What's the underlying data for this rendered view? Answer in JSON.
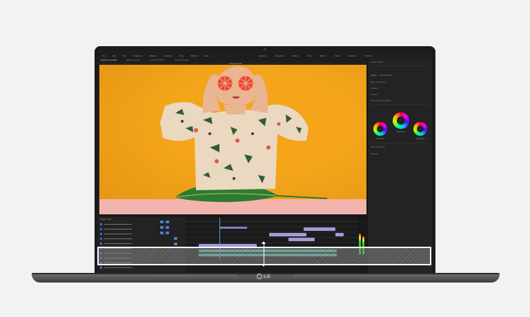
{
  "menubar": {
    "items": [
      "File",
      "Edit",
      "Clip",
      "Sequence",
      "Markers",
      "Graphics",
      "View",
      "Window",
      "Help"
    ],
    "workspaces": [
      "Learning",
      "Assembly",
      "Editing",
      "Color",
      "Effects",
      "Audio",
      "Graphics",
      "Libraries"
    ],
    "active_workspace": "Color"
  },
  "source_tabs": [
    "Source: (no clips)",
    "Effect Controls",
    "Audio Clip Mixer",
    "Lumetri Scopes"
  ],
  "program_title": "Program: Edit",
  "right_panel": {
    "title": "Lumetri Color",
    "tabs": [
      "Master",
      "Lumetri Color"
    ],
    "rows": [
      "Basic Correction",
      "Creative",
      "Curves",
      "Color Wheels & Match",
      "HSL Secondary",
      "Vignette"
    ],
    "wheel_labels": [
      "Shadows",
      "Midtones",
      "Highlights"
    ]
  },
  "project_panel": {
    "title": "Project: Edit",
    "row_count": 10
  },
  "laptop": {
    "brand": "LG"
  },
  "colors": {
    "backdrop": "#f4a51a",
    "table": "#f2b4ad",
    "accent": "#4aa3ff",
    "clip_purple": "#a79ad9",
    "clip_teal": "#5bb8a8",
    "highlight": "#ffffff"
  }
}
